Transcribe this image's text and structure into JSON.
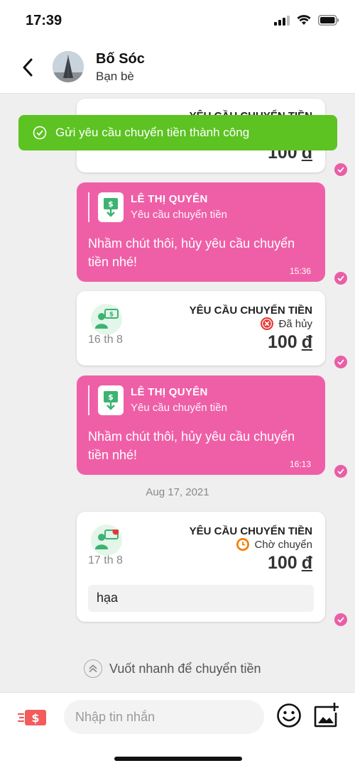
{
  "status_bar": {
    "time": "17:39"
  },
  "header": {
    "name": "Bố Sóc",
    "subtitle": "Bạn bè"
  },
  "toast": {
    "text": "Gửi yêu cầu chuyển tiền thành công"
  },
  "partial_card": {
    "title": "YÊU CẦU CHUYỂN TIỀN",
    "amount": "100",
    "currency": "đ"
  },
  "messages": [
    {
      "quoted_name": "LÊ THỊ QUYÊN",
      "quoted_type": "Yêu cầu chuyển tiền",
      "text": "Nhầm chút thôi, hủy yêu cầu chuyển tiền nhé!",
      "time": "15:36"
    },
    {
      "title": "YÊU CẦU CHUYỂN TIỀN",
      "status": "Đã hủy",
      "amount": "100",
      "currency": "đ",
      "date": "16 th 8"
    },
    {
      "quoted_name": "LÊ THỊ QUYÊN",
      "quoted_type": "Yêu cầu chuyển tiền",
      "text": "Nhầm chút thôi, hủy yêu cầu chuyển tiền nhé!",
      "time": "16:13"
    },
    {
      "title": "YÊU CẦU CHUYỂN TIỀN",
      "status": "Chờ chuyển",
      "amount": "100",
      "currency": "đ",
      "date": "17 th 8",
      "note": "hạa"
    }
  ],
  "date_separator": "Aug 17, 2021",
  "swipe_hint": "Vuốt nhanh để chuyển tiền",
  "input": {
    "placeholder": "Nhập tin nhắn"
  },
  "colors": {
    "pink": "#ef5fa7",
    "toast_green": "#5cc322",
    "cancel_red": "#e53935",
    "pending_orange": "#f57c00",
    "money_green": "#3cb371"
  },
  "icons": {
    "back": "chevron-left-icon",
    "cancel": "x-circle-icon",
    "pending": "clock-icon",
    "emoji": "smiley-icon",
    "image": "image-plus-icon",
    "send_money": "send-money-icon"
  }
}
